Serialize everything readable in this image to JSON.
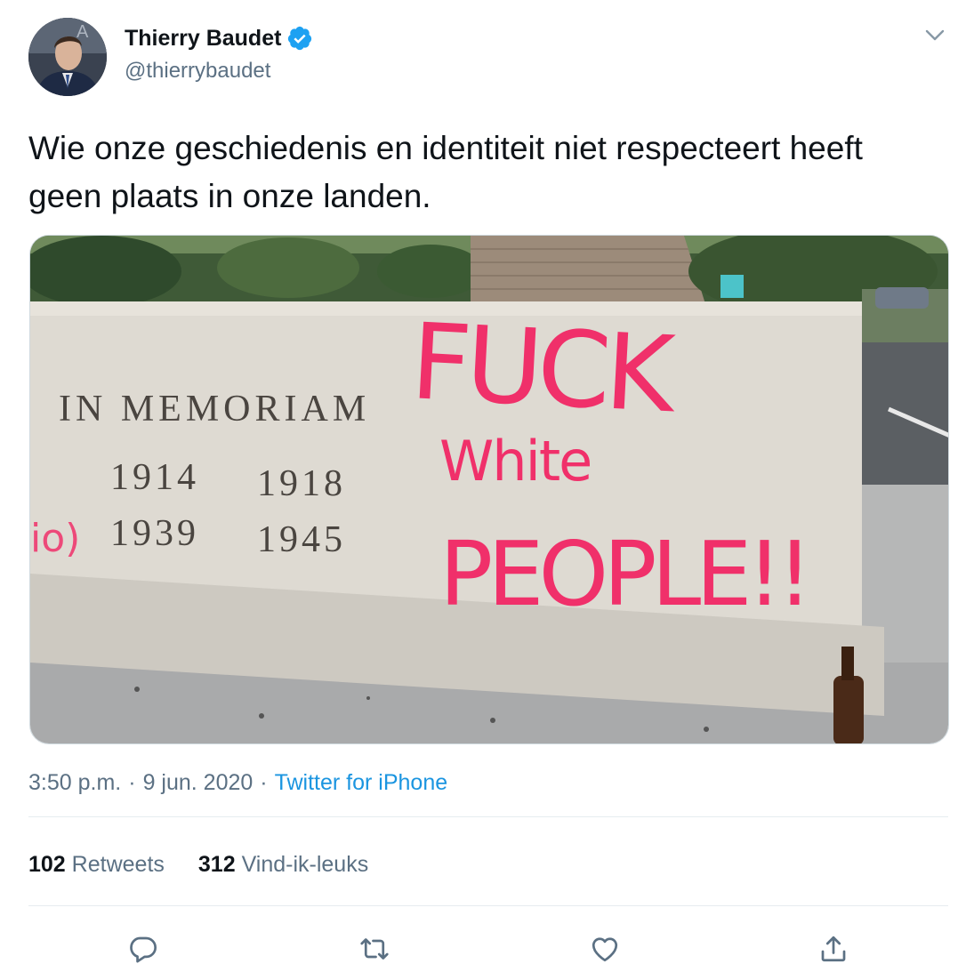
{
  "author": {
    "display_name": "Thierry Baudet",
    "handle": "@thierrybaudet",
    "verified": true
  },
  "tweet": {
    "text": "Wie onze geschiedenis en identiteit niet respecteert heeft geen plaats in onze landen."
  },
  "media": {
    "inscription_title": "IN MEMORIAM",
    "inscription_line1_a": "1914",
    "inscription_line1_b": "1918",
    "inscription_line2_a": "1939",
    "inscription_line2_b": "1945",
    "graffiti_line1": "FUCK",
    "graffiti_line2": "White",
    "graffiti_line3": "PEOPLE!!"
  },
  "meta": {
    "time": "3:50 p.m.",
    "separator": "·",
    "date": "9 jun. 2020",
    "source": "Twitter for iPhone"
  },
  "stats": {
    "retweets_count": "102",
    "retweets_label": "Retweets",
    "likes_count": "312",
    "likes_label": "Vind-ik-leuks"
  },
  "icons": {
    "reply": "reply-icon",
    "retweet": "retweet-icon",
    "like": "heart-icon",
    "share": "share-icon",
    "verified": "verified-badge-icon",
    "menu": "chevron-down-icon"
  },
  "colors": {
    "link": "#1b95e0",
    "secondary_text": "#5b7083",
    "verified": "#1da1f2",
    "graffiti": "#f0306a"
  }
}
